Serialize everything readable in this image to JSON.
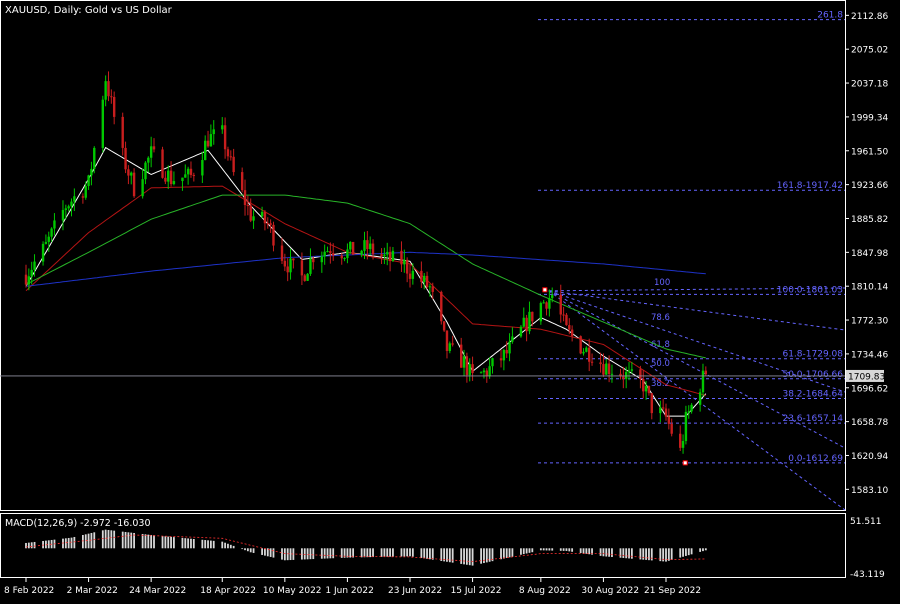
{
  "chart_title": "XAUUSD, Daily:  Gold vs US Dollar",
  "price_labels": [
    "2112.86",
    "2075.02",
    "2037.18",
    "1999.34",
    "1961.50",
    "1923.66",
    "1885.82",
    "1847.98",
    "1810.14",
    "1772.30",
    "1734.46",
    "1696.62",
    "1658.78",
    "1620.94",
    "1583.10"
  ],
  "current_price": "1709.83",
  "date_labels": [
    "8 Feb 2022",
    "2 Mar 2022",
    "24 Mar 2022",
    "18 Apr 2022",
    "10 May 2022",
    "1 Jun 2022",
    "23 Jun 2022",
    "15 Jul 2022",
    "8 Aug 2022",
    "30 Aug 2022",
    "21 Sep 2022"
  ],
  "macd": {
    "label": "MACD(12,26,9) -2.972 -16.030",
    "scale_top": "51.511",
    "scale_bottom": "-43.119"
  },
  "fibo": {
    "right_labels": [
      "261.8",
      "161.8-1917.42",
      "100.0-1801.03",
      "61.8-1729.08",
      "50.0-1706.66",
      "38.2-1684.64",
      "23.6-1657.14",
      "0.0-1612.69"
    ],
    "fan_labels": [
      "100",
      "78.6",
      "61.8",
      "50.0",
      "38.2"
    ]
  },
  "colors": {
    "background": "#000000",
    "bull_candle": "#00c800",
    "bear_candle": "#c81e1e",
    "ma_fast": "#ffffff",
    "ma_mid": "#b41414",
    "ma_slow": "#28b428",
    "ma_long": "#1e32c8",
    "fibo": "#6464ff",
    "macd_hist": "#d8d8d8",
    "macd_signal": "#ff3030",
    "text": "#ffffff"
  },
  "chart_data": {
    "type": "candlestick",
    "title": "XAUUSD, Daily:  Gold vs US Dollar",
    "y_axis": {
      "min": 1560,
      "max": 2130,
      "ticks": [
        2112.86,
        2075.02,
        2037.18,
        1999.34,
        1961.5,
        1923.66,
        1885.82,
        1847.98,
        1810.14,
        1772.3,
        1734.46,
        1696.62,
        1658.78,
        1620.94,
        1583.1
      ]
    },
    "x_ticks": [
      "8 Feb 2022",
      "2 Mar 2022",
      "24 Mar 2022",
      "18 Apr 2022",
      "10 May 2022",
      "1 Jun 2022",
      "23 Jun 2022",
      "15 Jul 2022",
      "8 Aug 2022",
      "30 Aug 2022",
      "21 Sep 2022"
    ],
    "close_anchors": [
      [
        "8 Feb 2022",
        1823
      ],
      [
        "15 Feb 2022",
        1855
      ],
      [
        "22 Feb 2022",
        1900
      ],
      [
        "2 Mar 2022",
        1925
      ],
      [
        "8 Mar 2022",
        2043
      ],
      [
        "14 Mar 2022",
        1955
      ],
      [
        "18 Mar 2022",
        1920
      ],
      [
        "24 Mar 2022",
        1958
      ],
      [
        "31 Mar 2022",
        1930
      ],
      [
        "7 Apr 2022",
        1933
      ],
      [
        "13 Apr 2022",
        1975
      ],
      [
        "18 Apr 2022",
        1980
      ],
      [
        "22 Apr 2022",
        1935
      ],
      [
        "28 Apr 2022",
        1890
      ],
      [
        "4 May 2022",
        1880
      ],
      [
        "10 May 2022",
        1838
      ],
      [
        "16 May 2022",
        1820
      ],
      [
        "20 May 2022",
        1845
      ],
      [
        "26 May 2022",
        1853
      ],
      [
        "1 Jun 2022",
        1848
      ],
      [
        "8 Jun 2022",
        1853
      ],
      [
        "15 Jun 2022",
        1840
      ],
      [
        "20 Jun 2022",
        1838
      ],
      [
        "23 Jun 2022",
        1827
      ],
      [
        "30 Jun 2022",
        1808
      ],
      [
        "6 Jul 2022",
        1740
      ],
      [
        "12 Jul 2022",
        1725
      ],
      [
        "15 Jul 2022",
        1707
      ],
      [
        "20 Jul 2022",
        1715
      ],
      [
        "27 Jul 2022",
        1735
      ],
      [
        "2 Aug 2022",
        1765
      ],
      [
        "8 Aug 2022",
        1790
      ],
      [
        "12 Aug 2022",
        1800
      ],
      [
        "17 Aug 2022",
        1760
      ],
      [
        "23 Aug 2022",
        1740
      ],
      [
        "26 Aug 2022",
        1735
      ],
      [
        "30 Aug 2022",
        1722
      ],
      [
        "6 Sep 2022",
        1712
      ],
      [
        "13 Sep 2022",
        1700
      ],
      [
        "16 Sep 2022",
        1675
      ],
      [
        "21 Sep 2022",
        1663
      ],
      [
        "26 Sep 2022",
        1625
      ],
      [
        "28 Sep 2022",
        1660
      ],
      [
        "3 Oct 2022",
        1700
      ],
      [
        "5 Oct 2022",
        1715
      ]
    ],
    "moving_averages": [
      {
        "color": "#ffffff",
        "anchors": [
          [
            "8 Feb 2022",
            1810
          ],
          [
            "2 Mar 2022",
            1930
          ],
          [
            "8 Mar 2022",
            1965
          ],
          [
            "24 Mar 2022",
            1935
          ],
          [
            "13 Apr 2022",
            1962
          ],
          [
            "28 Apr 2022",
            1900
          ],
          [
            "16 May 2022",
            1840
          ],
          [
            "1 Jun 2022",
            1848
          ],
          [
            "23 Jun 2022",
            1838
          ],
          [
            "6 Jul 2022",
            1770
          ],
          [
            "15 Jul 2022",
            1715
          ],
          [
            "27 Jul 2022",
            1745
          ],
          [
            "8 Aug 2022",
            1775
          ],
          [
            "17 Aug 2022",
            1762
          ],
          [
            "30 Aug 2022",
            1732
          ],
          [
            "13 Sep 2022",
            1705
          ],
          [
            "21 Sep 2022",
            1665
          ],
          [
            "28 Sep 2022",
            1665
          ],
          [
            "5 Oct 2022",
            1690
          ]
        ]
      },
      {
        "color": "#b41414",
        "anchors": [
          [
            "8 Feb 2022",
            1805
          ],
          [
            "2 Mar 2022",
            1870
          ],
          [
            "24 Mar 2022",
            1920
          ],
          [
            "18 Apr 2022",
            1922
          ],
          [
            "10 May 2022",
            1880
          ],
          [
            "1 Jun 2022",
            1848
          ],
          [
            "23 Jun 2022",
            1835
          ],
          [
            "15 Jul 2022",
            1768
          ],
          [
            "8 Aug 2022",
            1762
          ],
          [
            "30 Aug 2022",
            1745
          ],
          [
            "21 Sep 2022",
            1700
          ],
          [
            "5 Oct 2022",
            1688
          ]
        ]
      },
      {
        "color": "#28b428",
        "anchors": [
          [
            "8 Feb 2022",
            1812
          ],
          [
            "2 Mar 2022",
            1848
          ],
          [
            "24 Mar 2022",
            1885
          ],
          [
            "18 Apr 2022",
            1912
          ],
          [
            "10 May 2022",
            1912
          ],
          [
            "1 Jun 2022",
            1903
          ],
          [
            "23 Jun 2022",
            1880
          ],
          [
            "15 Jul 2022",
            1835
          ],
          [
            "8 Aug 2022",
            1800
          ],
          [
            "30 Aug 2022",
            1770
          ],
          [
            "21 Sep 2022",
            1740
          ],
          [
            "5 Oct 2022",
            1730
          ]
        ]
      },
      {
        "color": "#1e32c8",
        "anchors": [
          [
            "8 Feb 2022",
            1810
          ],
          [
            "24 Mar 2022",
            1827
          ],
          [
            "10 May 2022",
            1842
          ],
          [
            "23 Jun 2022",
            1848
          ],
          [
            "15 Jul 2022",
            1845
          ],
          [
            "30 Aug 2022",
            1835
          ],
          [
            "5 Oct 2022",
            1824
          ]
        ]
      }
    ],
    "fibonacci": [
      {
        "level": 261.8,
        "price": 2108.0
      },
      {
        "level": 161.8,
        "price": 1917.42
      },
      {
        "level": 100.0,
        "price": 1801.03
      },
      {
        "level": 61.8,
        "price": 1729.08
      },
      {
        "level": 50.0,
        "price": 1706.66
      },
      {
        "level": 38.2,
        "price": 1684.64
      },
      {
        "level": 23.6,
        "price": 1657.14
      },
      {
        "level": 0.0,
        "price": 1612.69
      }
    ],
    "fibo_fan": {
      "origin": [
        "8 Aug 2022",
        1805
      ],
      "levels": [
        100,
        78.6,
        61.8,
        50.0,
        38.2
      ]
    },
    "macd_indicator": {
      "params": "12,26,9",
      "main": -2.972,
      "signal": -16.03,
      "range": [
        -43.119,
        51.511
      ],
      "hist_anchors": [
        [
          "8 Feb 2022",
          8
        ],
        [
          "24 Feb 2022",
          16
        ],
        [
          "8 Mar 2022",
          28
        ],
        [
          "24 Mar 2022",
          20
        ],
        [
          "18 Apr 2022",
          10
        ],
        [
          "28 Apr 2022",
          -6
        ],
        [
          "10 May 2022",
          -18
        ],
        [
          "1 Jun 2022",
          -14
        ],
        [
          "23 Jun 2022",
          -12
        ],
        [
          "15 Jul 2022",
          -26
        ],
        [
          "8 Aug 2022",
          -3
        ],
        [
          "17 Aug 2022",
          -4
        ],
        [
          "30 Aug 2022",
          -12
        ],
        [
          "21 Sep 2022",
          -20
        ],
        [
          "5 Oct 2022",
          -3
        ]
      ],
      "signal_anchors": [
        [
          "8 Feb 2022",
          2
        ],
        [
          "2 Mar 2022",
          12
        ],
        [
          "18 Mar 2022",
          20
        ],
        [
          "18 Apr 2022",
          15
        ],
        [
          "10 May 2022",
          -8
        ],
        [
          "1 Jun 2022",
          -12
        ],
        [
          "23 Jun 2022",
          -13
        ],
        [
          "15 Jul 2022",
          -20
        ],
        [
          "8 Aug 2022",
          -8
        ],
        [
          "30 Aug 2022",
          -8
        ],
        [
          "21 Sep 2022",
          -17
        ],
        [
          "5 Oct 2022",
          -16
        ]
      ]
    }
  }
}
